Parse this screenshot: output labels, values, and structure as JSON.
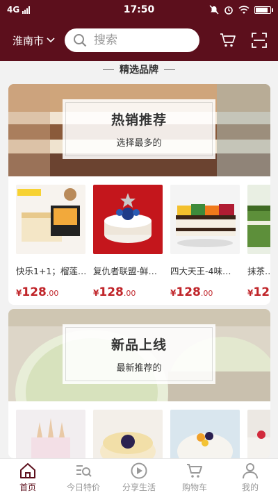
{
  "status": {
    "network": "4G",
    "time": "17:50"
  },
  "header": {
    "city": "淮南市",
    "search_placeholder": "搜索"
  },
  "section_title": "精选品牌",
  "sections": [
    {
      "title": "热销推荐",
      "subtitle": "选择最多的",
      "products": [
        {
          "name": "快乐1+1；榴莲…",
          "symbol": "¥",
          "int": "128",
          "dec": ".00"
        },
        {
          "name": "复仇者联盟-鲜…",
          "symbol": "¥",
          "int": "128",
          "dec": ".00"
        },
        {
          "name": "四大天王-4味…",
          "symbol": "¥",
          "int": "128",
          "dec": ".00"
        },
        {
          "name": "抹茶…",
          "symbol": "¥",
          "int": "12",
          "dec": ""
        }
      ]
    },
    {
      "title": "新品上线",
      "subtitle": "最新推荐的"
    }
  ],
  "tabbar": [
    {
      "label": "首页",
      "icon": "home-icon",
      "active": true
    },
    {
      "label": "今日特价",
      "icon": "special-offer-icon",
      "active": false
    },
    {
      "label": "分享生活",
      "icon": "play-icon",
      "active": false
    },
    {
      "label": "购物车",
      "icon": "cart-icon",
      "active": false
    },
    {
      "label": "我的",
      "icon": "user-icon",
      "active": false
    }
  ],
  "colors": {
    "brand": "#5c0f1c",
    "price": "#c0252a"
  }
}
